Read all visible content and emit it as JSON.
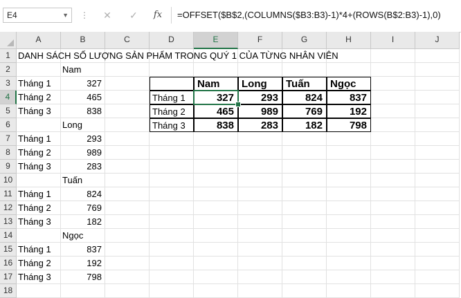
{
  "formula_bar": {
    "name_box": "E4",
    "cancel_icon": "✕",
    "enter_icon": "✓",
    "fx_label": "fx",
    "formula": "=OFFSET($B$2,(COLUMNS($B3:B3)-1)*4+(ROWS(B$2:B3)-1),0)"
  },
  "sheet": {
    "selected_cell": "E4",
    "columns": [
      "A",
      "B",
      "C",
      "D",
      "E",
      "F",
      "G",
      "H",
      "I",
      "J"
    ],
    "rows": [
      "1",
      "2",
      "3",
      "4",
      "5",
      "6",
      "7",
      "8",
      "9",
      "10",
      "11",
      "12",
      "13",
      "14",
      "15",
      "16",
      "17",
      "18"
    ],
    "title": "DANH SÁCH SỐ LƯỢNG SẢN PHẨM TRONG QUÝ 1 CỦA TỪNG NHÂN VIÊN",
    "source_list": [
      {
        "name": "Nam",
        "months": [
          "Tháng 1",
          "Tháng 2",
          "Tháng 3"
        ],
        "values": [
          "327",
          "465",
          "838"
        ]
      },
      {
        "name": "Long",
        "months": [
          "Tháng 1",
          "Tháng 2",
          "Tháng 3"
        ],
        "values": [
          "293",
          "989",
          "283"
        ]
      },
      {
        "name": "Tuấn",
        "months": [
          "Tháng 1",
          "Tháng 2",
          "Tháng 3"
        ],
        "values": [
          "824",
          "769",
          "182"
        ]
      },
      {
        "name": "Ngọc",
        "months": [
          "Tháng 1",
          "Tháng 2",
          "Tháng 3"
        ],
        "values": [
          "837",
          "192",
          "798"
        ]
      }
    ],
    "result_table": {
      "headers": [
        "Nam",
        "Long",
        "Tuấn",
        "Ngọc"
      ],
      "rows": [
        {
          "label": "Tháng 1",
          "values": [
            "327",
            "293",
            "824",
            "837"
          ]
        },
        {
          "label": "Tháng 2",
          "values": [
            "465",
            "989",
            "769",
            "192"
          ]
        },
        {
          "label": "Tháng 3",
          "values": [
            "838",
            "283",
            "182",
            "798"
          ]
        }
      ]
    },
    "colors": {
      "accent": "#217346",
      "header_bg": "#e9e9e9",
      "gridline": "#e1e1e1"
    }
  }
}
